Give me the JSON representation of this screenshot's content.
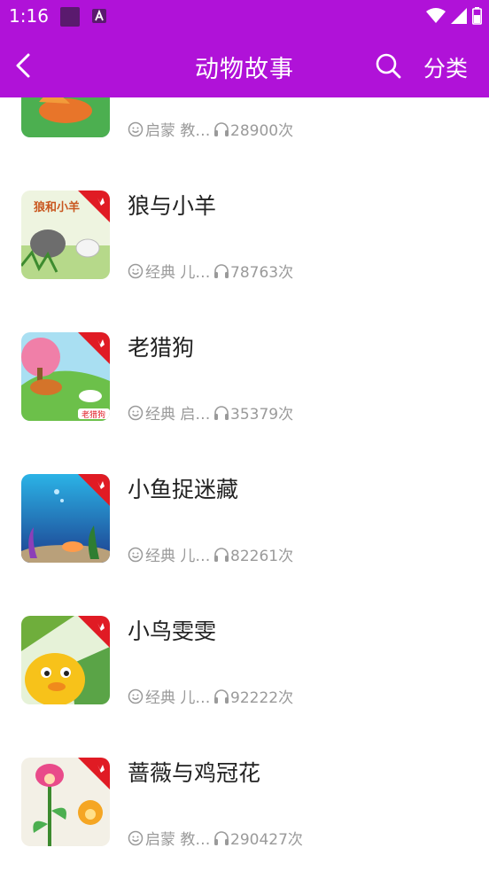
{
  "status_bar": {
    "time": "1:16"
  },
  "header": {
    "title": "动物故事",
    "category_label": "分类"
  },
  "items": [
    {
      "title": "",
      "tags": "启蒙 教…",
      "plays": "28900次",
      "theme": "fox"
    },
    {
      "title": "狼与小羊",
      "tags": "经典 儿…",
      "plays": "78763次",
      "theme": "wolf",
      "thumb_text": "狼和小羊"
    },
    {
      "title": "老猎狗",
      "tags": "经典 启…",
      "plays": "35379次",
      "theme": "dog",
      "thumb_text": "老猎狗"
    },
    {
      "title": "小鱼捉迷藏",
      "tags": "经典 儿…",
      "plays": "82261次",
      "theme": "sea"
    },
    {
      "title": "小鸟雯雯",
      "tags": "经典 儿…",
      "plays": "92222次",
      "theme": "bird"
    },
    {
      "title": "蔷薇与鸡冠花",
      "tags": "启蒙 教…",
      "plays": "290427次",
      "theme": "flower"
    }
  ],
  "colors": {
    "accent": "#b012d8",
    "badge": "#e01b24",
    "meta": "#9a9a9a"
  }
}
